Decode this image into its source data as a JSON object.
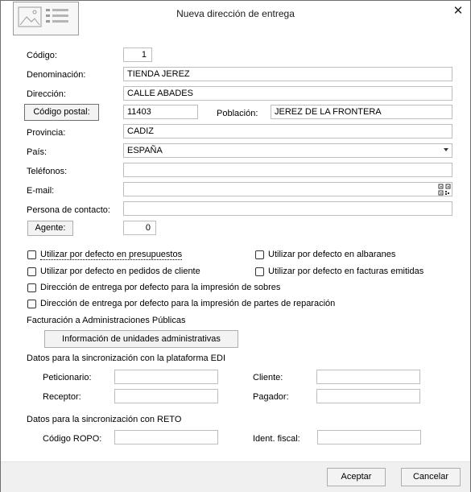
{
  "window": {
    "title": "Nueva dirección de entrega",
    "close_glyph": "✕"
  },
  "fields": {
    "codigo": {
      "label": "Código:",
      "value": "1"
    },
    "denominacion": {
      "label": "Denominación:",
      "value": "TIENDA JEREZ"
    },
    "direccion": {
      "label": "Dirección:",
      "value": "CALLE ABADES"
    },
    "codigo_postal": {
      "button": "Código postal:",
      "value": "11403"
    },
    "poblacion": {
      "label": "Población:",
      "value": "JEREZ DE LA FRONTERA"
    },
    "provincia": {
      "label": "Provincia:",
      "value": "CADIZ"
    },
    "pais": {
      "label": "País:",
      "value": "ESPAÑA"
    },
    "telefonos": {
      "label": "Teléfonos:",
      "value": ""
    },
    "email": {
      "label": "E-mail:",
      "value": ""
    },
    "persona_contacto": {
      "label": "Persona de contacto:",
      "value": ""
    },
    "agente": {
      "button": "Agente:",
      "value": "0"
    }
  },
  "checkboxes": {
    "presupuestos": "Utilizar por defecto en presupuestos",
    "albaranes": "Utilizar por defecto en albaranes",
    "pedidos": "Utilizar por defecto en pedidos de cliente",
    "facturas": "Utilizar por defecto en facturas emitidas",
    "sobres": "Dirección de entrega por defecto para la impresión de sobres",
    "partes": "Dirección de entrega por defecto para la impresión de partes de reparación"
  },
  "admin": {
    "section": "Facturación a Administraciones Públicas",
    "button": "Información de unidades administrativas"
  },
  "edi": {
    "section": "Datos para la sincronización con la plataforma EDI",
    "peticionario": "Peticionario:",
    "cliente": "Cliente:",
    "receptor": "Receptor:",
    "pagador": "Pagador:"
  },
  "reto": {
    "section": "Datos para la sincronización con RETO",
    "codigo_ropo": "Código ROPO:",
    "ident_fiscal": "Ident. fiscal:"
  },
  "footer": {
    "accept": "Aceptar",
    "cancel": "Cancelar"
  }
}
